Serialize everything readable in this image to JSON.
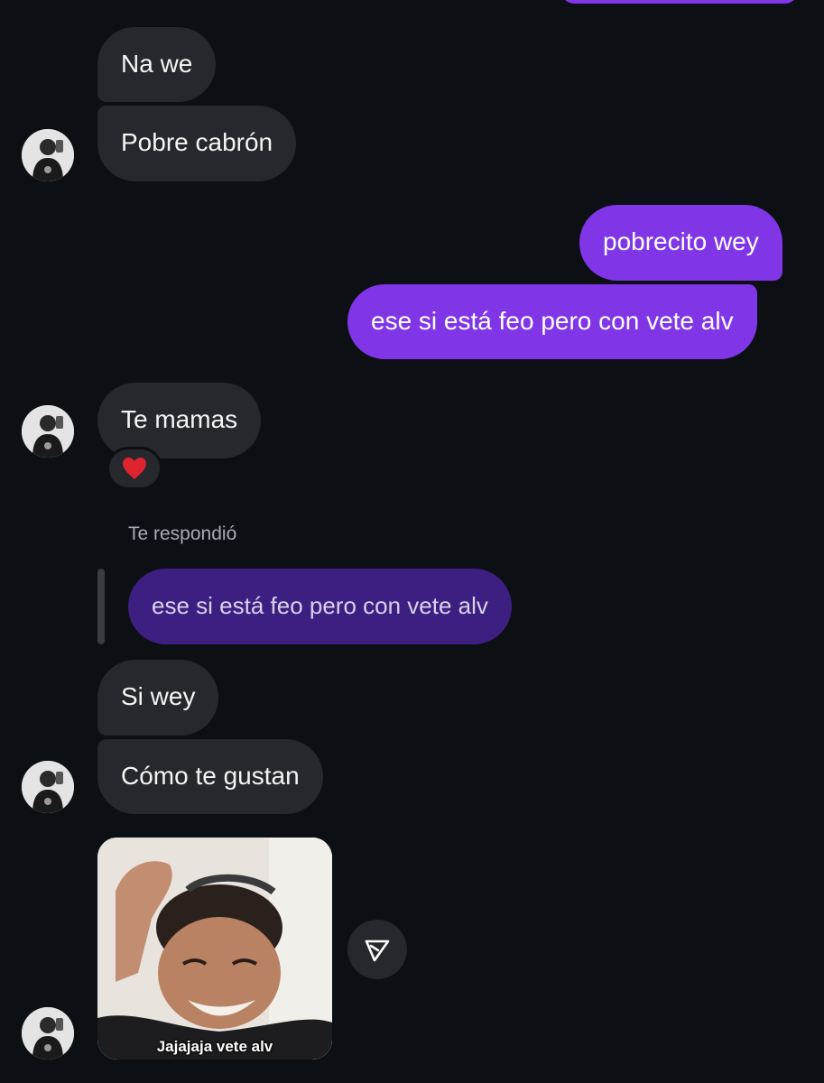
{
  "messages": {
    "m1": "Na we",
    "m2": "Pobre cabrón",
    "m3": "pobrecito wey",
    "m4": "ese si está feo pero con vete alv",
    "m5": "Te mamas",
    "m6": "Si wey",
    "m7": "Cómo te gustan"
  },
  "reaction": {
    "emoji": "heart-icon",
    "color": "#e0242f"
  },
  "reply": {
    "label": "Te respondió",
    "quoted_text": "ese si está feo pero con vete alv"
  },
  "media": {
    "caption": "Jajajaja vete alv"
  },
  "colors": {
    "background": "#0c0f14",
    "incoming_bubble": "#26282d",
    "outgoing_bubble": "#8036e6",
    "reply_quote_bubble": "#3d1f82"
  },
  "icons": {
    "share": "send-icon",
    "avatar": "avatar"
  }
}
